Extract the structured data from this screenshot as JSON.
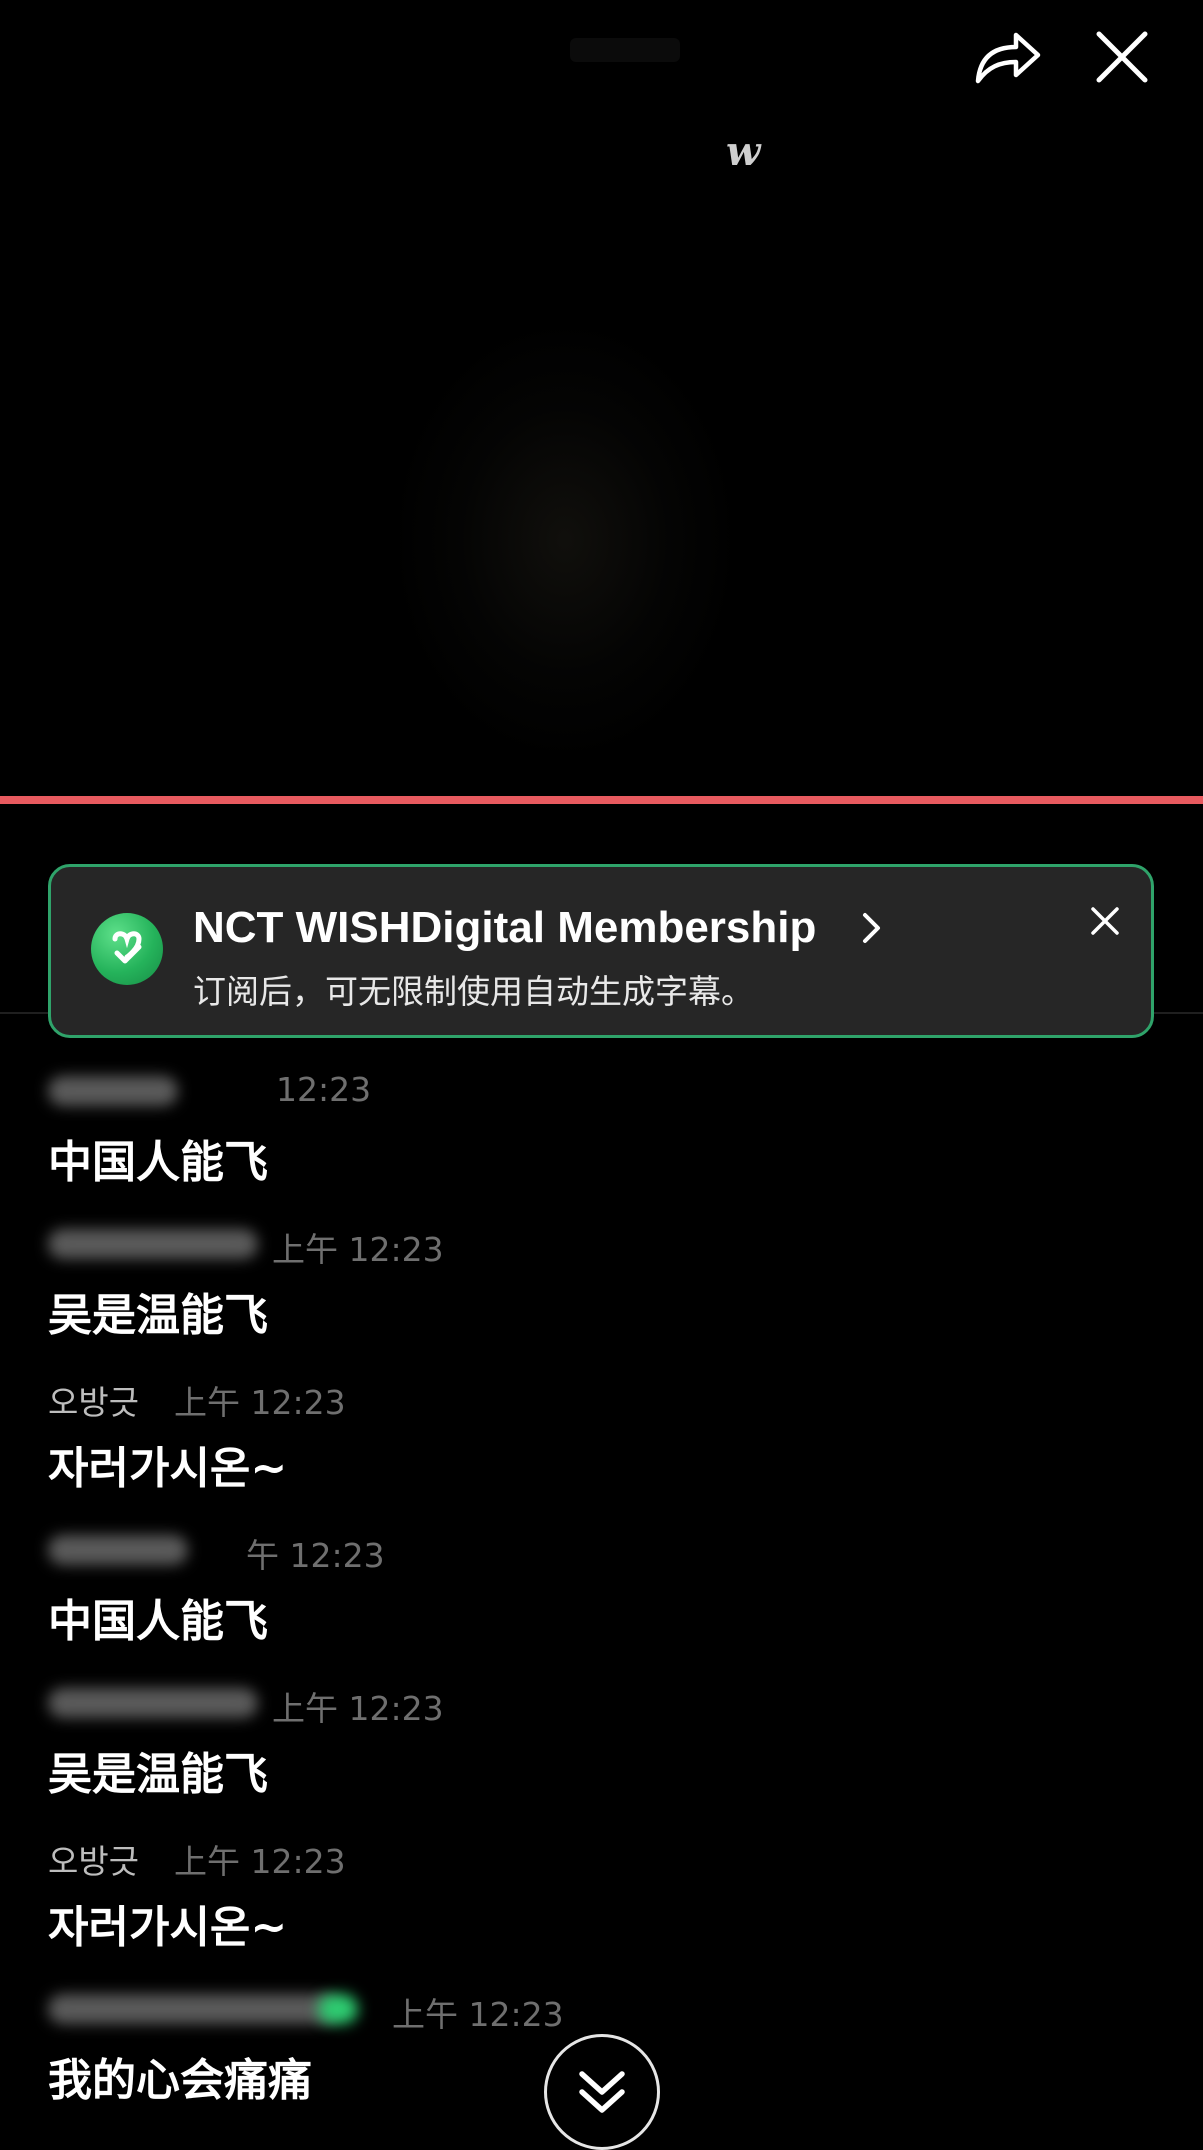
{
  "video": {
    "brand_logo": "w"
  },
  "promo": {
    "title": "NCT WISHDigital Membership",
    "subtitle": "订阅后，可无限制使用自动生成字幕。",
    "accent_color": "#2fa36a",
    "logo_color": "#25b35b"
  },
  "progress_color": "#e85a5f",
  "comments": [
    {
      "username": "",
      "time": "上午 12:23",
      "time_visible": "12:23",
      "text": "中国人能飞"
    },
    {
      "username": "",
      "time": "上午 12:23",
      "time_visible": "上午 12:23",
      "text": "吴是温能飞"
    },
    {
      "username": "오방긋",
      "time": "上午 12:23",
      "time_visible": "上午 12:23",
      "text": "자러가시온~"
    },
    {
      "username": "",
      "time": "上午 12:23",
      "time_visible": "午 12:23",
      "text": "中国人能飞"
    },
    {
      "username": "",
      "time": "上午 12:23",
      "time_visible": "上午 12:23",
      "text": "吴是温能飞"
    },
    {
      "username": "오방긋",
      "time": "上午 12:23",
      "time_visible": "上午 12:23",
      "text": "자러가시온~"
    },
    {
      "username": "",
      "time": "上午 12:23",
      "time_visible": "上午 12:23",
      "text": "我的心会痛痛"
    }
  ],
  "icons": {
    "share": "share-arrow-icon",
    "close": "close-icon",
    "promo_close": "close-icon",
    "chevron": "chevron-right-icon",
    "scroll_down": "double-chevron-down-icon"
  }
}
